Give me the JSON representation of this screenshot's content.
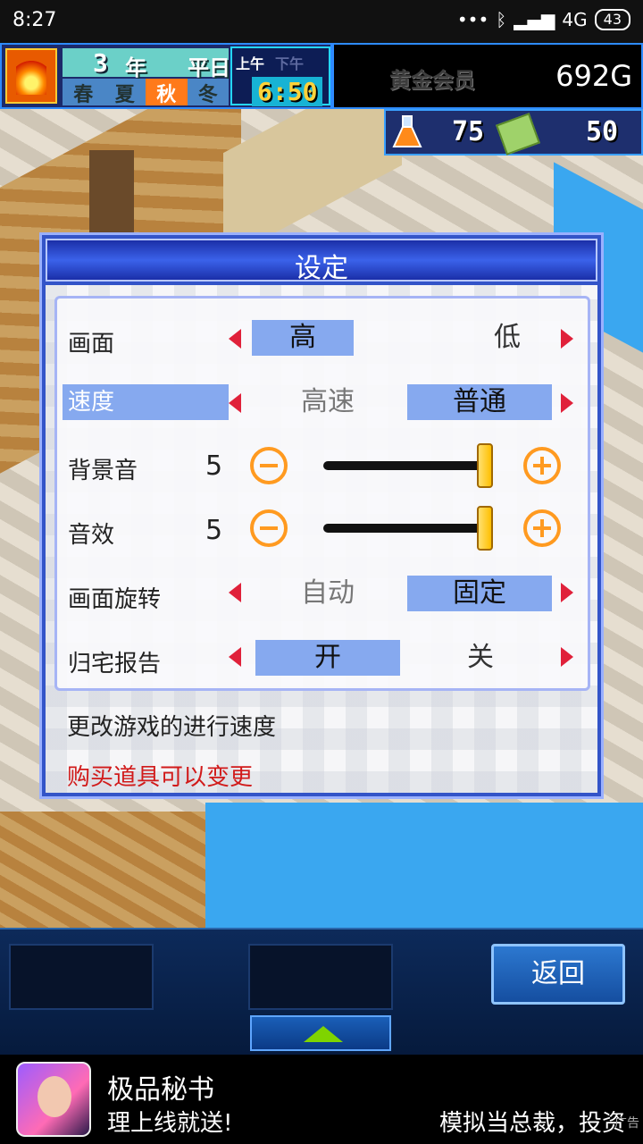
{
  "status_bar": {
    "time": "8:27",
    "network": "4G",
    "battery": "43"
  },
  "hud": {
    "year": "3",
    "year_suffix": "年",
    "weekday": "平日",
    "seasons": [
      "春",
      "夏",
      "秋",
      "冬"
    ],
    "active_season_index": 2,
    "am": "上午",
    "pm": "下午",
    "clock": "6:50",
    "member": "黄金会员",
    "money": "692G",
    "research_points": "75",
    "tickets": "50"
  },
  "dialog": {
    "title": "设定",
    "rows": {
      "graphics": {
        "label": "画面",
        "options": [
          "高",
          "低"
        ],
        "selected": "高"
      },
      "speed": {
        "label": "速度",
        "options": [
          "高速",
          "普通"
        ],
        "selected": "普通"
      },
      "bgm": {
        "label": "背景音",
        "value": "5",
        "level": 1.0
      },
      "sfx": {
        "label": "音效",
        "value": "5",
        "level": 1.0
      },
      "rotation": {
        "label": "画面旋转",
        "options": [
          "自动",
          "固定"
        ],
        "selected": "固定"
      },
      "home_report": {
        "label": "归宅报告",
        "options": [
          "开",
          "关"
        ],
        "selected": "开"
      }
    },
    "description": "更改游戏的进行速度",
    "note": "购买道具可以变更",
    "colors": {
      "note": "#d11a1a",
      "selected_bg": "#86a9ef",
      "arrow": "#e0213a",
      "slider_knob": "#ffbf00"
    }
  },
  "bottom": {
    "back_label": "返回"
  },
  "ad": {
    "title": "极品秘书",
    "subtitle": "理上线就送!",
    "right_text": "模拟当总裁，投资",
    "tag": "广告"
  }
}
